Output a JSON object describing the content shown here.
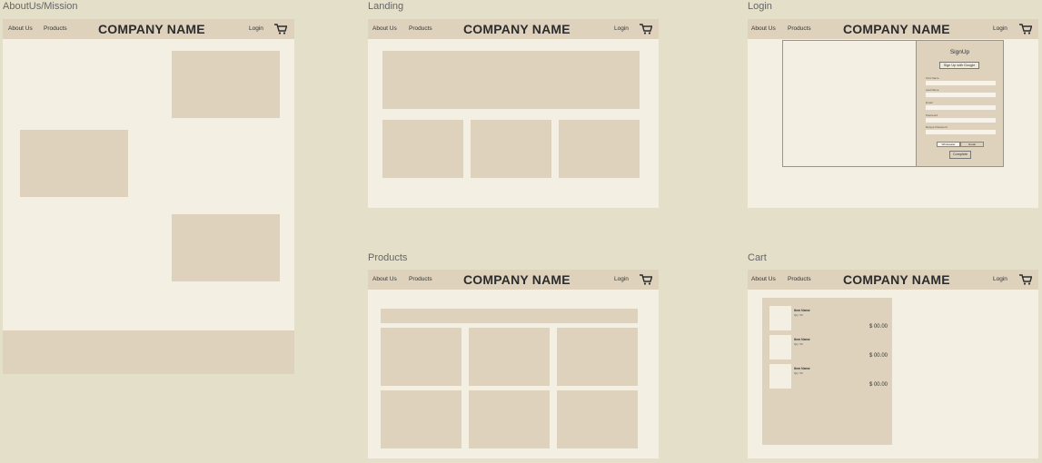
{
  "nav": {
    "about": "About Us",
    "products": "Products",
    "brand": "COMPANY NAME",
    "login": "Login",
    "cart_icon": "cart-icon"
  },
  "frames": {
    "about": {
      "title": "AboutUs/Mission"
    },
    "landing": {
      "title": "Landing"
    },
    "login": {
      "title": "Login"
    },
    "products": {
      "title": "Products"
    },
    "cart": {
      "title": "Cart"
    }
  },
  "signup": {
    "title": "SignUp",
    "google": "Sign Up with Google",
    "fields": [
      "First Name",
      "Last Name",
      "Email",
      "Password",
      "Retype Password"
    ],
    "toggle_left": "Wholesaler",
    "toggle_right": "Retail",
    "complete": "Complete"
  },
  "cart": {
    "items": [
      {
        "name": "Item Name",
        "qty": "Qty: 00",
        "price": "$ 00.00"
      },
      {
        "name": "Item Name",
        "qty": "Qty: 00",
        "price": "$ 00.00"
      },
      {
        "name": "Item Name",
        "qty": "Qty: 00",
        "price": "$ 00.00"
      }
    ]
  },
  "colors": {
    "background": "#e3dfc8",
    "frame": "#f3efe2",
    "block": "#ded2bc",
    "text": "#2c2c2c"
  }
}
